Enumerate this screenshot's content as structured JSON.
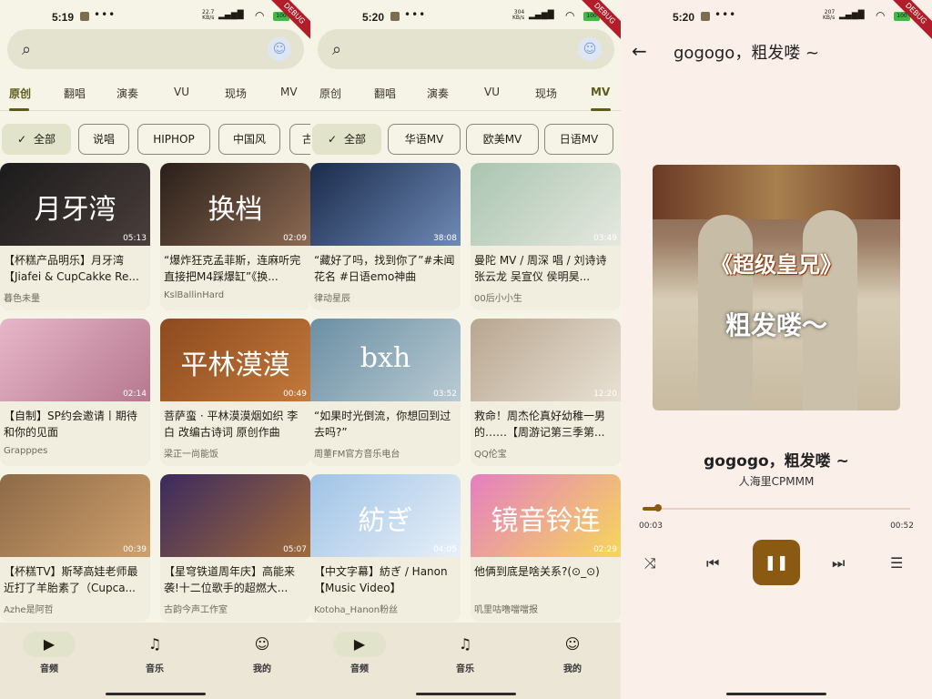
{
  "screens": [
    {
      "status": {
        "time": "5:19",
        "net": "22.7",
        "net_unit": "KB/s",
        "battery": "100"
      },
      "debug": "DEBUG",
      "tabs": [
        "原创",
        "翻唱",
        "演奏",
        "VU",
        "现场",
        "MV"
      ],
      "active_tab": 0,
      "chips": [
        {
          "label": "全部",
          "selected": true
        },
        {
          "label": "说唱"
        },
        {
          "label": "HIPHOP"
        },
        {
          "label": "中国风"
        },
        {
          "label": "古"
        }
      ],
      "cards": [
        {
          "title": "【杯糕产品明乐】月牙湾【Jiafei & CupCakke Re...",
          "author": "暮色未量",
          "duration": "05:13",
          "thumb_text": "月牙湾",
          "thumb_colors": [
            "#1b1b1b",
            "#4a3e3b"
          ]
        },
        {
          "title": "“爆炸狂克孟菲斯，连麻听完直接把M4踩爆缸”《换...",
          "author": "KslBallinHard",
          "duration": "02:09",
          "thumb_text": "换档",
          "thumb_colors": [
            "#2a1f1a",
            "#8c6a52"
          ]
        },
        {
          "title": "【自制】SP约会邀请丨期待和你的见面",
          "author": "Grapppes",
          "duration": "02:14",
          "thumb_text": "",
          "thumb_colors": [
            "#e7b6c9",
            "#b6788f"
          ]
        },
        {
          "title": "菩萨蛮 · 平林漠漠烟如织 李白 改编古诗词 原创作曲",
          "author": "梁正一尚能饭",
          "duration": "00:49",
          "thumb_text": "平林漠漠",
          "thumb_colors": [
            "#8d4a1f",
            "#c3793a"
          ]
        },
        {
          "title": "【杯糕TV】斯琴高娃老师最近打了羊胎素了（Cupca...",
          "author": "Azhe是阿哲",
          "duration": "00:39",
          "thumb_text": "",
          "thumb_colors": [
            "#8d6a47",
            "#cfa06c"
          ]
        },
        {
          "title": "【星穹铁道周年庆】高能来袭!十二位歌手的超燃大...",
          "author": "古韵今声工作室",
          "duration": "05:07",
          "thumb_text": "",
          "thumb_colors": [
            "#3b2a5e",
            "#a06a3a"
          ]
        }
      ],
      "nav": [
        {
          "label": "音频",
          "icon": "video-icon",
          "active": true
        },
        {
          "label": "音乐",
          "icon": "music-note-icon"
        },
        {
          "label": "我的",
          "icon": "profile-icon"
        }
      ]
    },
    {
      "status": {
        "time": "5:20",
        "net": "304",
        "net_unit": "KB/s",
        "battery": "100"
      },
      "debug": "DEBUG",
      "tabs": [
        "原创",
        "翻唱",
        "演奏",
        "VU",
        "现场",
        "MV"
      ],
      "active_tab": 5,
      "chips": [
        {
          "label": "全部",
          "selected": true
        },
        {
          "label": "华语MV"
        },
        {
          "label": "欧美MV"
        },
        {
          "label": "日语MV"
        }
      ],
      "cards": [
        {
          "title": "“藏好了吗，找到你了”#未闻花名 #日语emo神曲",
          "author": "律动星辰",
          "duration": "38:08",
          "thumb_text": "",
          "thumb_colors": [
            "#1a2b4c",
            "#6e8ab5"
          ]
        },
        {
          "title": "曼陀 MV / 周深 唱 / 刘诗诗 张云龙 吴宣仪 侯明昊...",
          "author": "00后小小生",
          "duration": "03:49",
          "thumb_text": "",
          "thumb_colors": [
            "#a9c5b0",
            "#e6e8df"
          ]
        },
        {
          "title": "“如果时光倒流，你想回到过去吗?”",
          "author": "周董FM官方音乐电台",
          "duration": "03:52",
          "thumb_text": "bxh",
          "thumb_colors": [
            "#6b8fa4",
            "#b9cbd3"
          ]
        },
        {
          "title": "救命！周杰伦真好幼稚一男的……【周游记第三季第...",
          "author": "QQ伦宝",
          "duration": "12:20",
          "thumb_text": "",
          "thumb_colors": [
            "#b8a690",
            "#e9e1d4"
          ]
        },
        {
          "title": "【中文字幕】紡ぎ / Hanon【Music Video】",
          "author": "Kotoha_Hanon粉丝",
          "duration": "04:05",
          "thumb_text": "紡ぎ",
          "thumb_colors": [
            "#9fc3e6",
            "#e8f0f8"
          ]
        },
        {
          "title": "他俩到底是啥关系?(⊙_⊙)",
          "author": "叽里咕噜噹噹报",
          "duration": "02:29",
          "thumb_text": "镜音铃连",
          "thumb_colors": [
            "#e57ec2",
            "#f6d75a"
          ]
        }
      ],
      "nav": [
        {
          "label": "音频",
          "icon": "video-icon",
          "active": true
        },
        {
          "label": "音乐",
          "icon": "music-note-icon"
        },
        {
          "label": "我的",
          "icon": "profile-icon"
        }
      ]
    }
  ],
  "player": {
    "status": {
      "time": "5:20",
      "net": "207",
      "net_unit": "KB/s",
      "battery": "100"
    },
    "debug": "DEBUG",
    "title": "gogogo，粗发喽 ~",
    "song": "gogogo，粗发喽 ~",
    "artist": "人海里CPMMM",
    "cover_text_1": "《超级皇兄》",
    "cover_text_2": "粗发喽～",
    "time_current": "00:03",
    "time_total": "00:52",
    "progress": 0.058,
    "accent": "#8a5a13"
  }
}
